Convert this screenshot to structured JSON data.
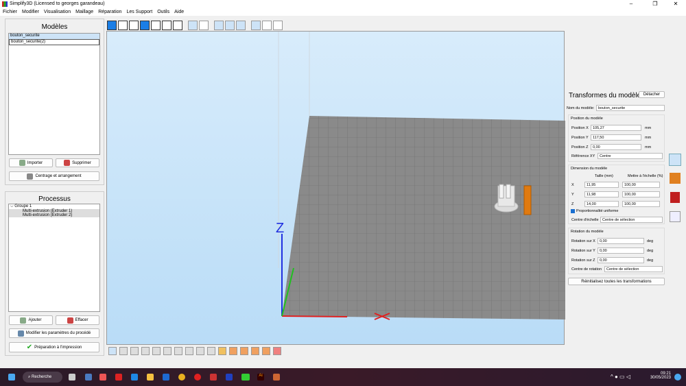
{
  "window": {
    "title": "Simplify3D (Licensed to georges garandeau)"
  },
  "menu": [
    "Fichier",
    "Modifier",
    "Visualisation",
    "Maillage",
    "Réparation",
    "Les Support",
    "Outils",
    "Aide"
  ],
  "models": {
    "title": "Modèles",
    "items": [
      "bouton_securite",
      "bouton_securite(2)"
    ],
    "import": "Importer",
    "delete": "Supprimer",
    "center": "Centrage et arrangement"
  },
  "processes": {
    "title": "Processus",
    "group": "Groupe 1",
    "items": [
      "Multi-extrusion (Extruder 1)",
      "Multi-extrusion (Extruder 2)"
    ],
    "add": "Ajouter",
    "remove": "Effacer",
    "edit": "Modifier les paramètres du procédé",
    "prepare": "Préparation à l'impression"
  },
  "viewport": {
    "axis_z": "Z"
  },
  "transforms": {
    "title": "Transformes du modèle",
    "detach": "Détacher",
    "name_label": "Nom du modèle:",
    "name": "bouton_securite",
    "position": {
      "title": "Position du modèle",
      "x_label": "Position X",
      "x": "105,27",
      "y_label": "Position Y",
      "y": "117,50",
      "z_label": "Position Z",
      "z": "0,00",
      "unit": "mm",
      "ref_label": "Référence XY",
      "ref": "Centre"
    },
    "dimension": {
      "title": "Dimension du modèle",
      "size_header": "Taille (mm)",
      "scale_header": "Mettre à l'échelle (%)",
      "rows": [
        {
          "axis": "X",
          "size": "11,95",
          "scale": "100,00"
        },
        {
          "axis": "Y",
          "size": "11,98",
          "scale": "100,00"
        },
        {
          "axis": "Z",
          "size": "14,00",
          "scale": "100,00"
        }
      ],
      "uniform": "Proportionnalité uniforme",
      "center_label": "Centre d'échelle",
      "center": "Centre de sélection"
    },
    "rotation": {
      "title": "Rotation du modèle",
      "x_label": "Rotation sur X",
      "x": "0,00",
      "y_label": "Rotation sur Y",
      "y": "0,00",
      "z_label": "Rotation sur Z",
      "z": "0,00",
      "unit": "deg",
      "center_label": "Centre de rotation",
      "center": "Centre de sélection"
    },
    "reset": "Réinitialisez toutes les transformations"
  },
  "taskbar": {
    "search": "Recherche",
    "time": "09:21",
    "date": "30/05/2023"
  }
}
